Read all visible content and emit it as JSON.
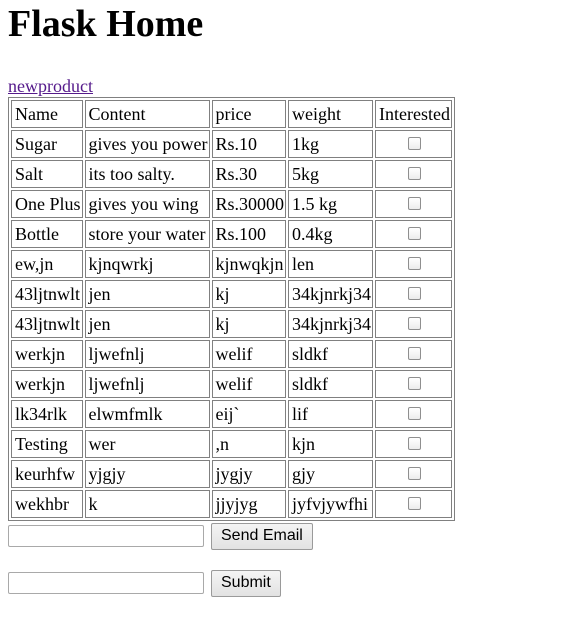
{
  "page_title": "Flask Home",
  "nav_link": "newproduct",
  "table": {
    "headers": [
      "Name",
      "Content",
      "price",
      "weight",
      "Interested"
    ],
    "rows": [
      [
        "Sugar",
        "gives you power",
        "Rs.10",
        "1kg"
      ],
      [
        "Salt",
        "its too salty.",
        "Rs.30",
        "5kg"
      ],
      [
        "One Plus",
        "gives you wing",
        "Rs.30000",
        "1.5 kg"
      ],
      [
        "Bottle",
        "store your water",
        "Rs.100",
        "0.4kg"
      ],
      [
        "ew,jn",
        "kjnqwrkj",
        "kjnwqkjn",
        "len"
      ],
      [
        "43ljtnwlt",
        "jen",
        "kj",
        "34kjnrkj34"
      ],
      [
        "43ljtnwlt",
        "jen",
        "kj",
        "34kjnrkj34"
      ],
      [
        "werkjn",
        "ljwefnlj",
        "welif",
        "sldkf"
      ],
      [
        "werkjn",
        "ljwefnlj",
        "welif",
        "sldkf"
      ],
      [
        "lk34rlk",
        "elwmfmlk",
        "eij`",
        "lif"
      ],
      [
        "Testing",
        "wer",
        ",n",
        "kjn"
      ],
      [
        "keurhfw",
        "yjgjy",
        "jygjy",
        "gjy"
      ],
      [
        "wekhbr",
        "k",
        "jjyjyg",
        "jyfvjywfhi"
      ]
    ],
    "interested_checked": [
      false,
      false,
      false,
      false,
      false,
      false,
      false,
      false,
      false,
      false,
      false,
      false,
      false
    ]
  },
  "email_form": {
    "input_value": "",
    "button_label": "Send Email"
  },
  "submit_form": {
    "input_value": "",
    "button_label": "Submit"
  }
}
